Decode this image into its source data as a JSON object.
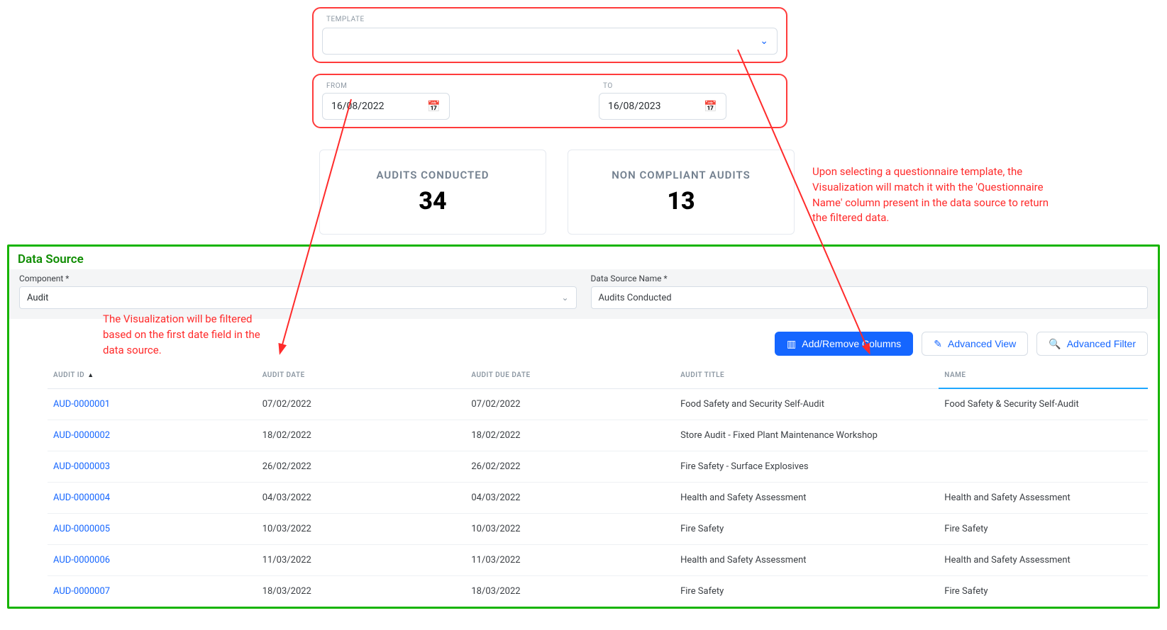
{
  "filters": {
    "template_label": "TEMPLATE",
    "from_label": "FROM",
    "to_label": "TO",
    "from_value": "16/08/2022",
    "to_value": "16/08/2023"
  },
  "kpi": {
    "audits_label": "AUDITS CONDUCTED",
    "audits_value": "34",
    "nc_label": "NON COMPLIANT AUDITS",
    "nc_value": "13"
  },
  "datasource": {
    "title": "Data Source",
    "component_label": "Component *",
    "component_value": "Audit",
    "dsname_label": "Data Source Name *",
    "dsname_value": "Audits Conducted"
  },
  "toolbar": {
    "add_remove": "Add/Remove Columns",
    "adv_view": "Advanced View",
    "adv_filter": "Advanced Filter"
  },
  "columns": {
    "c0": "AUDIT ID",
    "c1": "AUDIT DATE",
    "c2": "AUDIT DUE DATE",
    "c3": "AUDIT TITLE",
    "c4": "NAME"
  },
  "rows": [
    {
      "id": "AUD-0000001",
      "date": "07/02/2022",
      "due": "07/02/2022",
      "title": "Food Safety and Security Self-Audit",
      "name": "Food Safety & Security Self-Audit"
    },
    {
      "id": "AUD-0000002",
      "date": "18/02/2022",
      "due": "18/02/2022",
      "title": "Store Audit - Fixed Plant Maintenance Workshop",
      "name": ""
    },
    {
      "id": "AUD-0000003",
      "date": "26/02/2022",
      "due": "26/02/2022",
      "title": "Fire Safety - Surface Explosives",
      "name": ""
    },
    {
      "id": "AUD-0000004",
      "date": "04/03/2022",
      "due": "04/03/2022",
      "title": "Health and Safety Assessment",
      "name": "Health and Safety Assessment"
    },
    {
      "id": "AUD-0000005",
      "date": "10/03/2022",
      "due": "10/03/2022",
      "title": "Fire Safety",
      "name": "Fire Safety"
    },
    {
      "id": "AUD-0000006",
      "date": "11/03/2022",
      "due": "11/03/2022",
      "title": "Health and Safety Assessment",
      "name": "Health and Safety Assessment"
    },
    {
      "id": "AUD-0000007",
      "date": "18/03/2022",
      "due": "18/03/2022",
      "title": "Fire Safety",
      "name": "Fire Safety"
    }
  ],
  "annotations": {
    "right": "Upon selecting a questionnaire template, the Visualization will match it with the 'Questionnaire Name' column present in the data source to return the filtered data.",
    "left": "The Visualization will be filtered based on the first date field in the data source."
  }
}
